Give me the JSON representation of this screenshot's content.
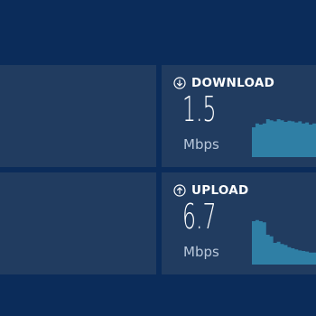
{
  "colors": {
    "background": "#0b2c5a",
    "tile": "#213c60",
    "sparkline": "#2f7fa5",
    "text": "#ffffff",
    "unit_text": "#b8c7da"
  },
  "download": {
    "icon": "arrow-down-circle-icon",
    "label": "DOWNLOAD",
    "value": "1.5",
    "unit": "Mbps",
    "sparkline": [
      0.55,
      0.62,
      0.6,
      0.62,
      0.7,
      0.68,
      0.66,
      0.7,
      0.68,
      0.65,
      0.67,
      0.66,
      0.64,
      0.66,
      0.62,
      0.64,
      0.6,
      0.62
    ]
  },
  "upload": {
    "icon": "arrow-up-circle-icon",
    "label": "UPLOAD",
    "value": "6.7",
    "unit": "Mbps",
    "sparkline": [
      0.8,
      0.82,
      0.8,
      0.78,
      0.55,
      0.52,
      0.4,
      0.42,
      0.38,
      0.36,
      0.32,
      0.3,
      0.28,
      0.26,
      0.25,
      0.24,
      0.22,
      0.22
    ]
  }
}
